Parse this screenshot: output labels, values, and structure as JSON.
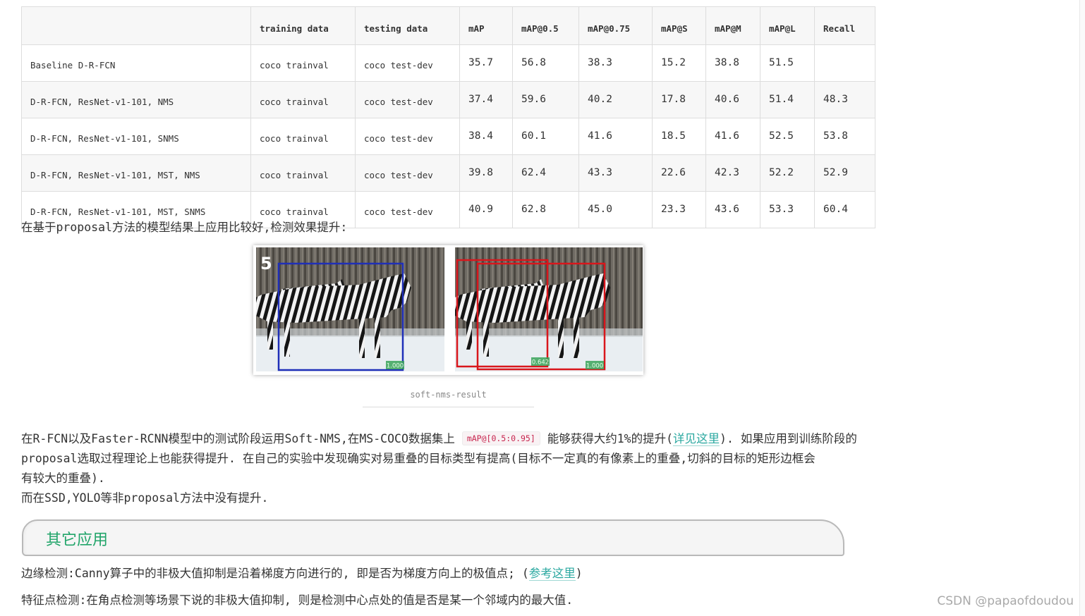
{
  "table": {
    "headers": [
      "",
      "training data",
      "testing data",
      "mAP",
      "mAP@0.5",
      "mAP@0.75",
      "mAP@S",
      "mAP@M",
      "mAP@L",
      "Recall"
    ],
    "rows": [
      [
        "Baseline D-R-FCN",
        "coco trainval",
        "coco test-dev",
        "35.7",
        "56.8",
        "38.3",
        "15.2",
        "38.8",
        "51.5",
        ""
      ],
      [
        "D-R-FCN, ResNet-v1-101, NMS",
        "coco trainval",
        "coco test-dev",
        "37.4",
        "59.6",
        "40.2",
        "17.8",
        "40.6",
        "51.4",
        "48.3"
      ],
      [
        "D-R-FCN, ResNet-v1-101, SNMS",
        "coco trainval",
        "coco test-dev",
        "38.4",
        "60.1",
        "41.6",
        "18.5",
        "41.6",
        "52.5",
        "53.8"
      ],
      [
        "D-R-FCN, ResNet-v1-101, MST, NMS",
        "coco trainval",
        "coco test-dev",
        "39.8",
        "62.4",
        "43.3",
        "22.6",
        "42.3",
        "52.2",
        "52.9"
      ],
      [
        "D-R-FCN, ResNet-v1-101, MST, SNMS",
        "coco trainval",
        "coco test-dev",
        "40.9",
        "62.8",
        "45.0",
        "23.3",
        "43.6",
        "53.3",
        "60.4"
      ]
    ]
  },
  "intro_text": "在基于proposal方法的模型结果上应用比较好,检测效果提升:",
  "figure": {
    "panel_number": "5",
    "left_score": "1.000",
    "right_score_a": "0.642",
    "right_score_b": "1.000",
    "colors": {
      "left_box": "#1f2fb8",
      "right_box": "#d9161c",
      "score_bg": "#3aa35a"
    }
  },
  "caption": "soft-nms-result",
  "body": {
    "line1_a": "在R-FCN以及Faster-RCNN模型中的测试阶段运用Soft-NMS,在MS-COCO数据集上",
    "line1_code": "mAP@[0.5:0.95]",
    "line1_b": "能够获得大约1%的提升(",
    "line1_link": "详见这里",
    "line1_c": "). 如果应用到训练阶段的",
    "line2": "proposal选取过程理论上也能获得提升. 在自己的实验中发现确实对易重叠的目标类型有提高(目标不一定真的有像素上的重叠,切斜的目标的矩形边框会",
    "line3": "有较大的重叠).",
    "line4": "而在SSD,YOLO等非proposal方法中没有提升."
  },
  "section": {
    "title": "其它应用"
  },
  "edge": {
    "text_a": "边缘检测:Canny算子中的非极大值抑制是沿着梯度方向进行的, 即是否为梯度方向上的极值点; (",
    "link": "参考这里",
    "text_b": ")"
  },
  "feature_text": "特征点检测:在角点检测等场景下说的非极大值抑制, 则是检测中心点处的值是否是某一个邻域内的最大值.",
  "watermark": "CSDN @papaofdoudou",
  "colors": {
    "accent": "#22a56a",
    "link": "#2aa8a0",
    "code": "#c7254e"
  }
}
